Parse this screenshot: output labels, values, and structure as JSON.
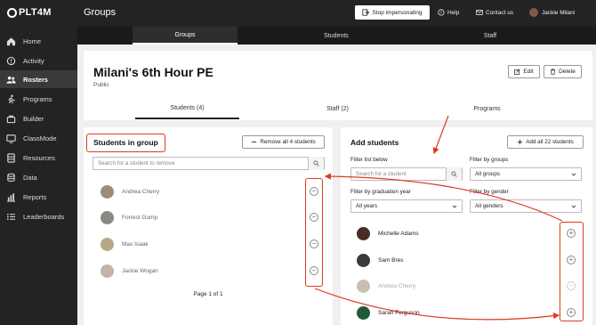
{
  "app": {
    "logo_text": "PLT4M",
    "title": "Groups"
  },
  "sidebar": {
    "items": [
      {
        "label": "Home",
        "icon": "home-icon"
      },
      {
        "label": "Activity",
        "icon": "activity-icon"
      },
      {
        "label": "Rosters",
        "icon": "rosters-icon",
        "active": true
      },
      {
        "label": "Programs",
        "icon": "programs-icon"
      },
      {
        "label": "Builder",
        "icon": "builder-icon"
      },
      {
        "label": "ClassMode",
        "icon": "classmode-icon"
      },
      {
        "label": "Resources",
        "icon": "resources-icon"
      },
      {
        "label": "Data",
        "icon": "data-icon"
      },
      {
        "label": "Reports",
        "icon": "reports-icon"
      },
      {
        "label": "Leaderboards",
        "icon": "leaderboards-icon"
      }
    ]
  },
  "topbar": {
    "impersonate_label": "Stop impersonating",
    "help_label": "Help",
    "contact_label": "Contact us",
    "user_name": "Jackie Milani"
  },
  "top_tabs": [
    "Groups",
    "Students",
    "Staff"
  ],
  "group": {
    "name": "Milani's 6th Hour PE",
    "visibility": "Public",
    "edit_label": "Edit",
    "delete_label": "Delete",
    "tabs": [
      "Students (4)",
      "Staff (2)",
      "Programs"
    ]
  },
  "students_in_group": {
    "title": "Students in group",
    "remove_all_label": "Remove all 4 students",
    "search_placeholder": "Search for a student to remove",
    "students": [
      "Andrea Cherry",
      "Forrest Gump",
      "Max Isaak",
      "Jackie Wogan"
    ],
    "pagination": "Page 1 of 1"
  },
  "add_students": {
    "title": "Add students",
    "add_all_label": "Add all 22 students",
    "filter_list_label": "Filter list below",
    "search_placeholder": "Search for a student",
    "filter_groups_label": "Filter by groups",
    "groups_value": "All groups",
    "filter_grad_label": "Filter by graduation year",
    "grad_value": "All years",
    "filter_gender_label": "Filter by gender",
    "gender_value": "All genders",
    "students": [
      {
        "name": "Michelle Adams",
        "in_group": false
      },
      {
        "name": "Sam Bres",
        "in_group": false
      },
      {
        "name": "Andrea Cherry",
        "in_group": true
      },
      {
        "name": "Sarah Ferguson",
        "in_group": false
      }
    ]
  },
  "colors": {
    "annotation": "#e0391d",
    "nav_bg": "#232323"
  }
}
